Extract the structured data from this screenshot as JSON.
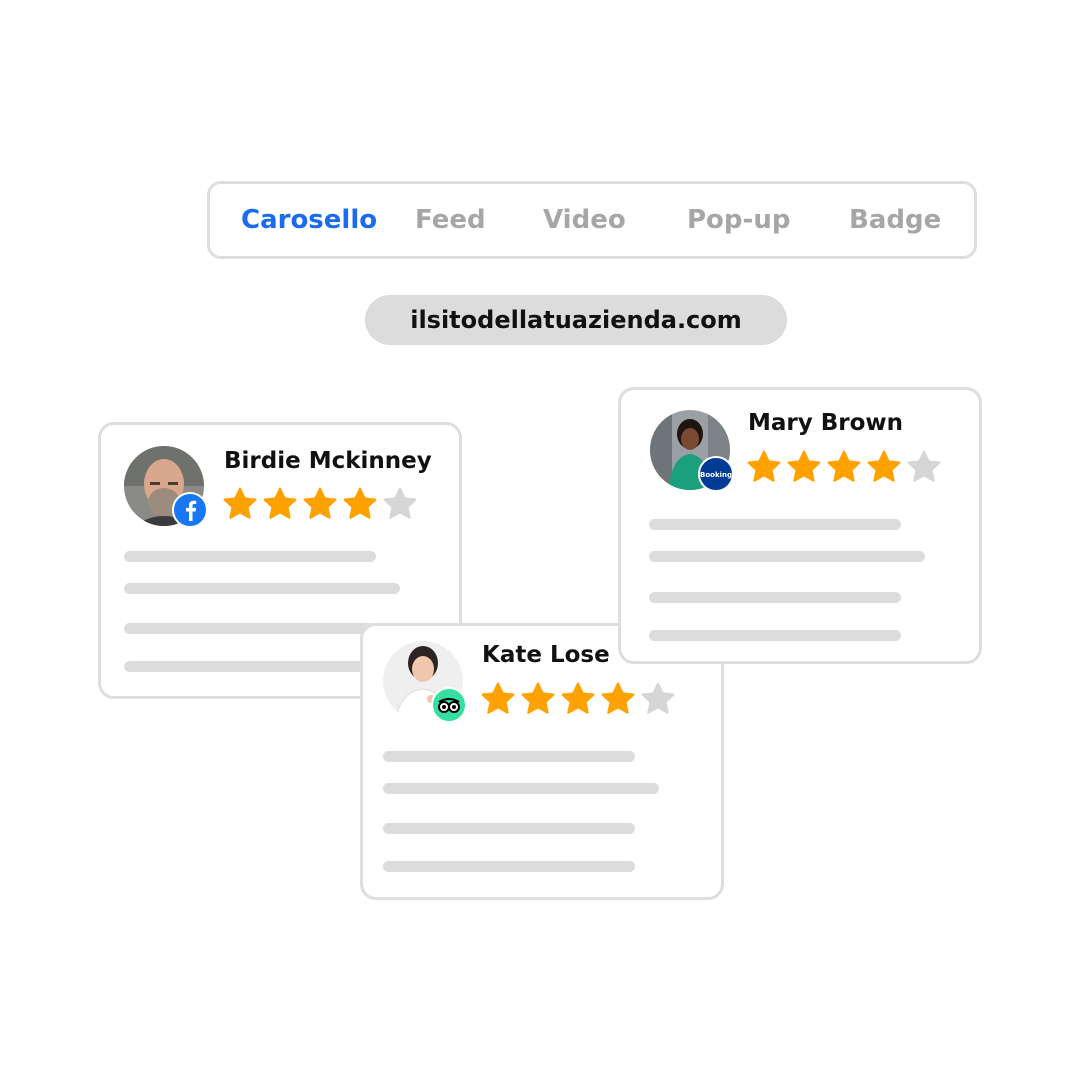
{
  "tabs": [
    {
      "label": "Carosello",
      "active": true
    },
    {
      "label": "Feed",
      "active": false
    },
    {
      "label": "Video",
      "active": false
    },
    {
      "label": "Pop-up",
      "active": false
    },
    {
      "label": "Badge",
      "active": false
    }
  ],
  "url": "ilsitodellatuazienda.com",
  "reviews": [
    {
      "name": "Birdie Mckinney",
      "rating": 4,
      "max_rating": 5,
      "source_icon": "facebook-icon"
    },
    {
      "name": "Kate Lose",
      "rating": 4,
      "max_rating": 5,
      "source_icon": "tripadvisor-icon"
    },
    {
      "name": "Mary Brown",
      "rating": 4,
      "max_rating": 5,
      "source_icon": "booking-icon",
      "source_label": "Booking"
    }
  ],
  "colors": {
    "accent": "#1a6bf0",
    "star_filled": "#ffa200",
    "star_empty": "#d6d6d6",
    "facebook": "#1877f2",
    "tripadvisor": "#34e0a1",
    "booking": "#003b95"
  }
}
